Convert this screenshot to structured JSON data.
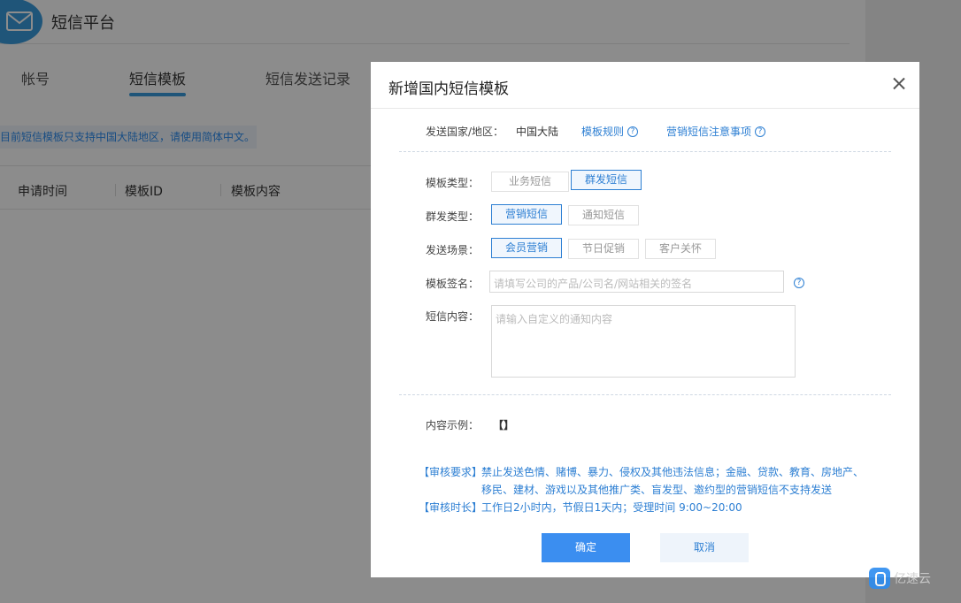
{
  "app": {
    "title": "短信平台"
  },
  "tabs": [
    "帐号",
    "短信模板",
    "短信发送记录"
  ],
  "notice": "目前短信模板只支持中国大陆地区，请使用简体中文。",
  "table": {
    "headers": [
      "申请时间",
      "模板ID",
      "模板内容"
    ]
  },
  "modal": {
    "title": "新增国内短信模板",
    "country_label": "发送国家/地区：",
    "country_value": "中国大陆",
    "rules_link": "模板规则",
    "marketing_link": "营销短信注意事项",
    "template_type_label": "模板类型：",
    "template_type_options": [
      "业务短信",
      "群发短信"
    ],
    "template_type_selected": "群发短信",
    "mass_type_label": "群发类型：",
    "mass_type_options": [
      "营销短信",
      "通知短信"
    ],
    "mass_type_selected": "营销短信",
    "scene_label": "发送场景：",
    "scene_options": [
      "会员营销",
      "节日促销",
      "客户关怀"
    ],
    "scene_selected": "会员营销",
    "signature_label": "模板签名：",
    "signature_placeholder": "请填写公司的产品/公司名/网站相关的签名",
    "content_label": "短信内容：",
    "content_placeholder": "请输入自定义的通知内容",
    "example_label": "内容示例：",
    "example_value": "【】",
    "review_req_tag": "【审核要求】",
    "review_req_line1": "禁止发送色情、赌博、暴力、侵权及其他违法信息；金融、贷款、教育、房地产、",
    "review_req_line2": "移民、建材、游戏以及其他推广类、盲发型、邀约型的营销短信不支持发送",
    "review_time_tag": "【审核时长】",
    "review_time_text": "工作日2小时内，节假日1天内；受理时间 9:00~20:00",
    "confirm_label": "确定",
    "cancel_label": "取消"
  },
  "watermark": {
    "text": "亿速云"
  }
}
